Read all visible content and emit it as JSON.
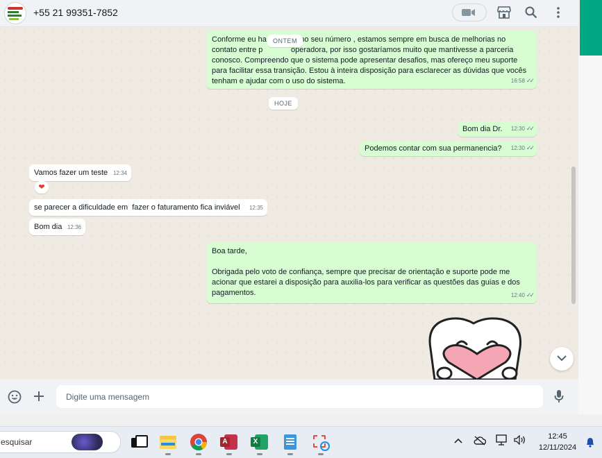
{
  "header": {
    "contact_phone": "+55 21 99351-7852",
    "icons": [
      "video-call-icon",
      "shop-icon",
      "search-icon",
      "menu-dots-icon"
    ]
  },
  "chat": {
    "day_yesterday": "ONTEM",
    "day_today": "HOJE",
    "messages": [
      {
        "dir": "out",
        "text_lines": [
          "Conforme eu ha",
          "do no seu número , estamos sempre em busca de melhorias no",
          "contato entre p",
          "operadora, por isso gostaríamos muito que mantivesse a parceria",
          "conosco. Compreendo que o sistema pode apresentar desafios, mas ofereço meu suporte",
          "para facilitar essa transição. Estou à inteira disposição para esclarecer as dúvidas que vocês",
          "tenham e ajudar com o uso do sistema."
        ],
        "time": "16:58"
      },
      {
        "dir": "out",
        "text": "Bom dia Dr.",
        "time": "12:30"
      },
      {
        "dir": "out",
        "text": "Podemos contar com sua permanencia?",
        "time": "12:30"
      },
      {
        "dir": "in",
        "text": "Vamos fazer um teste",
        "time": "12:34",
        "reaction": "❤"
      },
      {
        "dir": "in",
        "text": "se parecer a dificuldade em  fazer o faturamento fica inviável",
        "time": "12:35"
      },
      {
        "dir": "in",
        "text": "Bom dia",
        "time": "12:36"
      },
      {
        "dir": "out",
        "text_lines": [
          "Boa tarde,",
          "",
          "Obrigada pelo voto de confiança, sempre que precisar de orientação e suporte pode me",
          "acionar que estarei a disposição para auxilia-los para verificar as questões das guias e dos",
          "pagamentos."
        ],
        "time": "12:40"
      }
    ]
  },
  "compose": {
    "placeholder": "Digite uma mensagem",
    "icons": [
      "emoji-icon",
      "plus-icon",
      "microphone-icon"
    ]
  },
  "taskbar": {
    "search_text": "esquisar",
    "apps": [
      "task-view",
      "file-explorer",
      "chrome",
      "access",
      "excel",
      "notepad",
      "snipping-tool"
    ],
    "time": "12:45",
    "date": "12/11/2024"
  },
  "colors": {
    "accent": "#00a884",
    "outgoing_bubble": "#d9fdd3",
    "incoming_bubble": "#ffffff",
    "chat_bg": "#efeae2"
  }
}
